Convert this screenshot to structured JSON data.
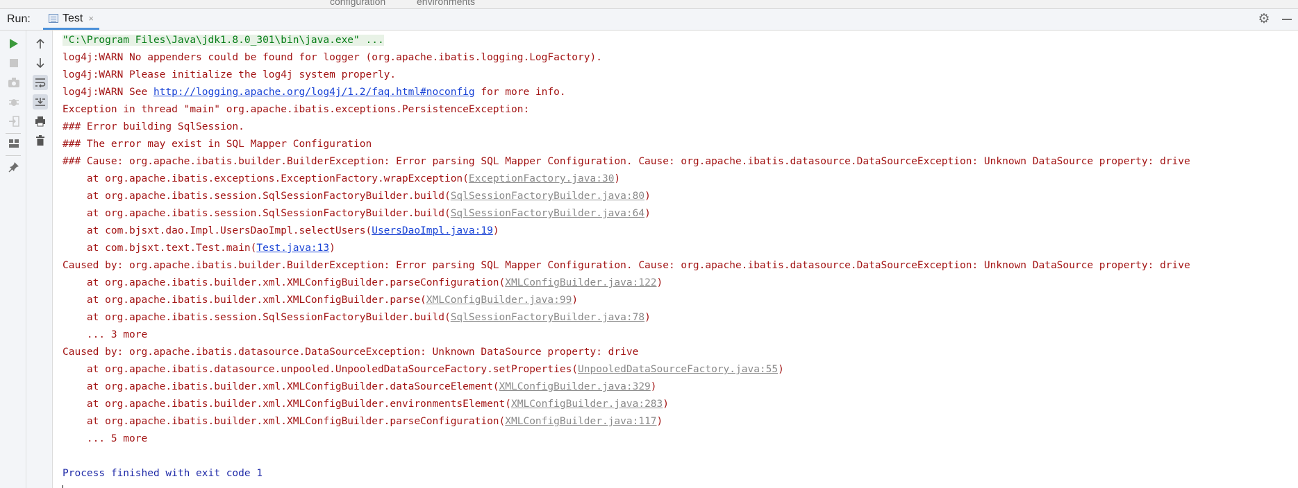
{
  "top_strip": {
    "left": "configuration",
    "right": "environments"
  },
  "header": {
    "run_label": "Run:",
    "tab_label": "Test",
    "tab_close": "×"
  },
  "toolbar": {
    "icons": [
      "play-icon",
      "stop-icon",
      "camera-icon",
      "debug-icon",
      "login-icon",
      "layout-icon",
      "pin-icon",
      "up-arrow-icon",
      "down-arrow-icon",
      "soft-wrap-icon",
      "scroll-end-icon",
      "print-icon",
      "trash-icon"
    ]
  },
  "console": {
    "lines": [
      {
        "type": "cmd",
        "text": "\"C:\\Program Files\\Java\\jdk1.8.0_301\\bin\\java.exe\" ..."
      },
      {
        "type": "err",
        "text": "log4j:WARN No appenders could be found for logger (org.apache.ibatis.logging.LogFactory)."
      },
      {
        "type": "err",
        "text": "log4j:WARN Please initialize the log4j system properly."
      },
      {
        "type": "err",
        "pre": "log4j:WARN See ",
        "link": "http://logging.apache.org/log4j/1.2/faq.html#noconfig",
        "link_class": "link",
        "post": " for more info."
      },
      {
        "type": "err",
        "text": "Exception in thread \"main\" org.apache.ibatis.exceptions.PersistenceException: "
      },
      {
        "type": "err",
        "text": "### Error building SqlSession."
      },
      {
        "type": "err",
        "text": "### The error may exist in SQL Mapper Configuration"
      },
      {
        "type": "err",
        "text": "### Cause: org.apache.ibatis.builder.BuilderException: Error parsing SQL Mapper Configuration. Cause: org.apache.ibatis.datasource.DataSourceException: Unknown DataSource property: drive"
      },
      {
        "type": "err",
        "pre": "    at org.apache.ibatis.exceptions.ExceptionFactory.wrapException(",
        "link": "ExceptionFactory.java:30",
        "link_class": "glink",
        "post": ")"
      },
      {
        "type": "err",
        "pre": "    at org.apache.ibatis.session.SqlSessionFactoryBuilder.build(",
        "link": "SqlSessionFactoryBuilder.java:80",
        "link_class": "glink",
        "post": ")"
      },
      {
        "type": "err",
        "pre": "    at org.apache.ibatis.session.SqlSessionFactoryBuilder.build(",
        "link": "SqlSessionFactoryBuilder.java:64",
        "link_class": "glink",
        "post": ")"
      },
      {
        "type": "err",
        "pre": "    at com.bjsxt.dao.Impl.UsersDaoImpl.selectUsers(",
        "link": "UsersDaoImpl.java:19",
        "link_class": "link",
        "post": ")"
      },
      {
        "type": "err",
        "pre": "    at com.bjsxt.text.Test.main(",
        "link": "Test.java:13",
        "link_class": "link",
        "post": ")"
      },
      {
        "type": "err",
        "text": "Caused by: org.apache.ibatis.builder.BuilderException: Error parsing SQL Mapper Configuration. Cause: org.apache.ibatis.datasource.DataSourceException: Unknown DataSource property: drive"
      },
      {
        "type": "err",
        "pre": "    at org.apache.ibatis.builder.xml.XMLConfigBuilder.parseConfiguration(",
        "link": "XMLConfigBuilder.java:122",
        "link_class": "glink",
        "post": ")"
      },
      {
        "type": "err",
        "pre": "    at org.apache.ibatis.builder.xml.XMLConfigBuilder.parse(",
        "link": "XMLConfigBuilder.java:99",
        "link_class": "glink",
        "post": ")"
      },
      {
        "type": "err",
        "pre": "    at org.apache.ibatis.session.SqlSessionFactoryBuilder.build(",
        "link": "SqlSessionFactoryBuilder.java:78",
        "link_class": "glink",
        "post": ")"
      },
      {
        "type": "err",
        "text": "    ... 3 more"
      },
      {
        "type": "err",
        "text": "Caused by: org.apache.ibatis.datasource.DataSourceException: Unknown DataSource property: drive"
      },
      {
        "type": "err",
        "pre": "    at org.apache.ibatis.datasource.unpooled.UnpooledDataSourceFactory.setProperties(",
        "link": "UnpooledDataSourceFactory.java:55",
        "link_class": "glink",
        "post": ")"
      },
      {
        "type": "err",
        "pre": "    at org.apache.ibatis.builder.xml.XMLConfigBuilder.dataSourceElement(",
        "link": "XMLConfigBuilder.java:329",
        "link_class": "glink",
        "post": ")"
      },
      {
        "type": "err",
        "pre": "    at org.apache.ibatis.builder.xml.XMLConfigBuilder.environmentsElement(",
        "link": "XMLConfigBuilder.java:283",
        "link_class": "glink",
        "post": ")"
      },
      {
        "type": "err",
        "pre": "    at org.apache.ibatis.builder.xml.XMLConfigBuilder.parseConfiguration(",
        "link": "XMLConfigBuilder.java:117",
        "link_class": "glink",
        "post": ")"
      },
      {
        "type": "err",
        "text": "    ... 5 more"
      },
      {
        "type": "blank",
        "text": ""
      },
      {
        "type": "info",
        "text": "Process finished with exit code 1"
      }
    ]
  },
  "colors": {
    "error": "#a31515",
    "link": "#1a44d6",
    "info": "#1f2aa8",
    "run_green": "#3c9a3c"
  }
}
